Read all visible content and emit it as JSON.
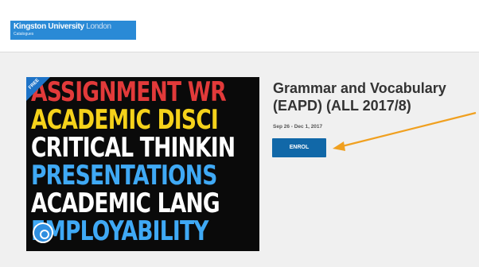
{
  "header": {
    "logo_line1": "Kingston University",
    "logo_line1_sub": "London",
    "logo_line2": "Catalogues"
  },
  "course": {
    "badge": "FREE",
    "thumbnail_lines": [
      {
        "text": "ASSIGNMENT WR",
        "color": "#e23a3a"
      },
      {
        "text": "ACADEMIC DISCI",
        "color": "#f5d21b"
      },
      {
        "text": "CRITICAL THINKIN",
        "color": "#ffffff"
      },
      {
        "text": "PRESENTATIONS",
        "color": "#3fa9f5"
      },
      {
        "text": "ACADEMIC LANG",
        "color": "#ffffff"
      },
      {
        "text": "EMPLOYABILITY",
        "color": "#3fa9f5"
      }
    ],
    "title": "Grammar and Vocabulary (EAPD) (ALL 2017/8)",
    "dates": "Sep 26 - Dec 1, 2017",
    "enrol_label": "ENROL"
  },
  "colors": {
    "accent": "#1168a8",
    "annotation_arrow": "#f0a020"
  }
}
